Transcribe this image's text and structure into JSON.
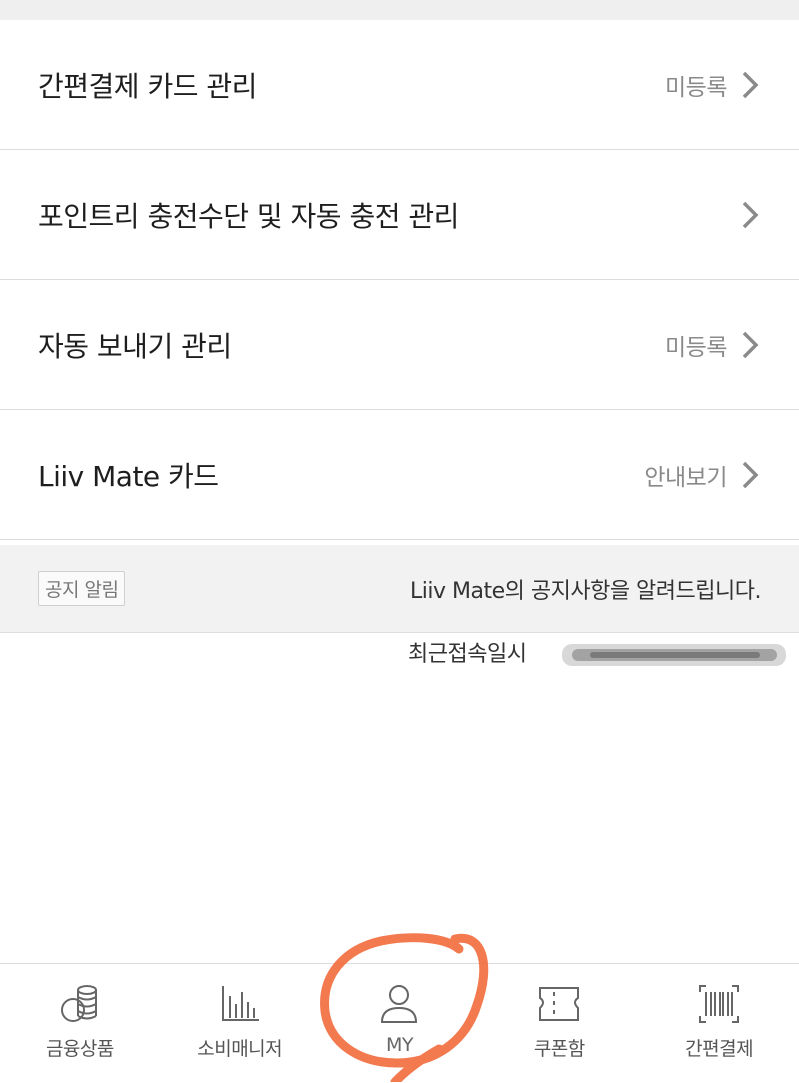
{
  "menu": {
    "items": [
      {
        "label": "간편결제 카드 관리",
        "status": "미등록"
      },
      {
        "label": "포인트리 충전수단 및 자동 충전 관리",
        "status": ""
      },
      {
        "label": "자동 보내기 관리",
        "status": "미등록"
      },
      {
        "label": "Liiv Mate 카드",
        "status": "안내보기"
      }
    ]
  },
  "notice": {
    "tag": "공지 알림",
    "message": "Liiv Mate의 공지사항을 알려드립니다."
  },
  "last_access": {
    "label": "최근접속일시"
  },
  "tabbar": {
    "tabs": [
      {
        "label": "금융상품",
        "icon": "coins-icon"
      },
      {
        "label": "소비매니저",
        "icon": "bar-chart-icon"
      },
      {
        "label": "MY",
        "icon": "person-icon"
      },
      {
        "label": "쿠폰함",
        "icon": "ticket-icon"
      },
      {
        "label": "간편결제",
        "icon": "barcode-icon"
      }
    ]
  },
  "colors": {
    "annotation": "#f26a3c",
    "divider": "#dcdcdc",
    "notice_bg": "#f2f2f2"
  }
}
